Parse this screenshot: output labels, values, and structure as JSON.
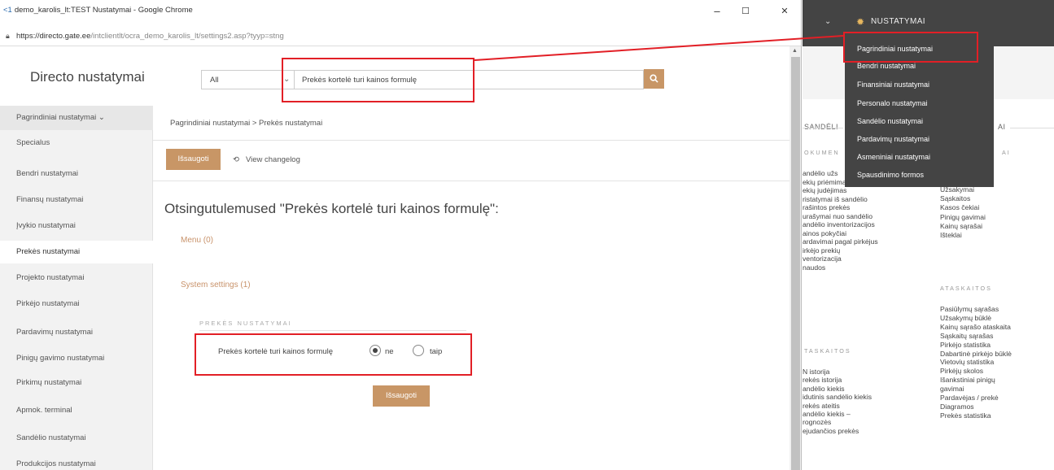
{
  "window": {
    "title": "demo_karolis_lt:TEST Nustatymai - Google Chrome",
    "url_main": "https://directo.gate.ee",
    "url_path": "/intclientlt/ocra_demo_karolis_lt/settings2.asp?tyyp=stng",
    "controls": {
      "minimize": "–",
      "maximize": "☐",
      "close": "✕"
    }
  },
  "header": {
    "app_title": "Directo nustatymai",
    "filter_value": "All",
    "search_value": "Prekės kortelė turi kainos formulę"
  },
  "sidebar": {
    "header": "Pagrindiniai nustatymai",
    "items": [
      {
        "label": "Specialus"
      },
      {
        "label": "Bendri nustatymai"
      },
      {
        "label": "Finansų nustatymai"
      },
      {
        "label": "Įvykio nustatymai"
      },
      {
        "label": "Prekės nustatymai"
      },
      {
        "label": "Projekto nustatymai"
      },
      {
        "label": "Pirkėjo nustatymai"
      },
      {
        "label": "Pardavimų nustatymai"
      },
      {
        "label": "Pinigų gavimo nustatymai"
      },
      {
        "label": "Pirkimų nustatymai"
      },
      {
        "label": "Apmok. terminal"
      },
      {
        "label": "Sandėlio nustatymai"
      },
      {
        "label": "Produkcijos nustatymai"
      }
    ],
    "active_index": 4
  },
  "main": {
    "breadcrumb": "Pagrindiniai nustatymai > Prekės nustatymai",
    "save_label": "Išsaugoti",
    "changelog_label": "View changelog",
    "results_title": "Otsingutulemused \"Prekės kortelė turi kainos formulę\":",
    "menu_link": "Menu (0)",
    "system_link": "System settings (1)",
    "section_title": "PREKĖS NUSTATYMAI",
    "setting_label": "Prekės kortelė turi kainos formulę",
    "options": [
      {
        "label": "ne",
        "selected": true
      },
      {
        "label": "taip",
        "selected": false
      }
    ],
    "save_bottom_label": "Išsaugoti"
  },
  "right_panel": {
    "menu_title": "NUSTATYMAI",
    "dropdown_items": [
      "Pagrindiniai nustatymai",
      "Bendri nustatymai",
      "Finansiniai nustatymai",
      "Personalo nustatymai",
      "Sandėlio nustatymai",
      "Pardavimų nustatymai",
      "Asmeniniai nustatymai",
      "Spausdinimo formos"
    ],
    "bg_heading_left": "SANDĖLI",
    "bg_heading_right": "AI",
    "col1_sub1": "OKUMEN",
    "col2_sub1": "AI",
    "col1_items": [
      "andėlio užs",
      "ekių priėmimai",
      "ekių judėjimas",
      "ristatymai iš sandėlio",
      "rašintos prekės",
      "urašymai nuo sandėlio",
      "andėlio inventorizacijos",
      "ainos pokyčiai",
      "ardavimai pagal pirkėjus",
      "irkėjo prekių",
      "ventorizacija",
      "naudos"
    ],
    "col1_sub2": "TASKAITOS",
    "col1_items2": [
      "N istorija",
      "rekės istorija",
      "andėlio kiekis",
      "idutinis sandėlio kiekis",
      "rekės ateitis",
      "andėlio kiekis –",
      "rognozės",
      "ejudančios prekės"
    ],
    "col2_items": [
      "Užsakymai",
      "Sąskaitos",
      "Kasos čekiai",
      "Pinigų gavimai",
      "Kainų sąrašai",
      "Išteklai"
    ],
    "col2_sub2": "ATASKAITOS",
    "col2_items2": [
      "Pasiūlymų sąrašas",
      "Užsakymų būklė",
      "Kainų sąrašo ataskaita",
      "Sąskaitų sąrašas",
      "Pirkėjo statistika",
      "Dabartinė pirkėjo būklė",
      "Vietovių statistika",
      "Pirkėjų skolos",
      "Išankstiniai pinigų",
      "gavimai",
      "Pardavėjas / prekė",
      "Diagramos",
      "Prekės statistika"
    ]
  },
  "colors": {
    "accent": "#c89666",
    "link": "#c8926a",
    "highlight": "#e21f26",
    "menu_bg": "#444444"
  }
}
